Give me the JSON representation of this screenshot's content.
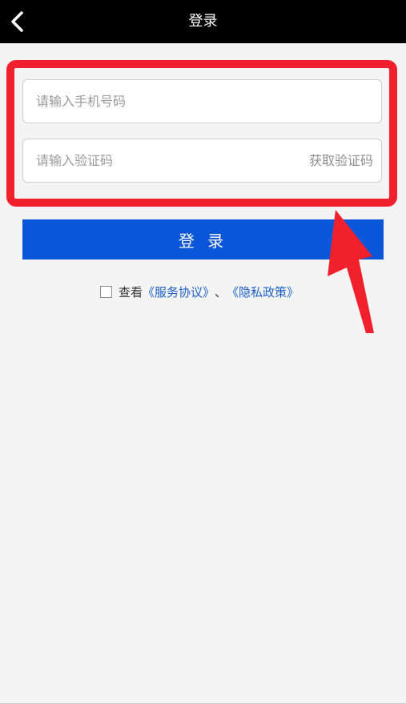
{
  "header": {
    "title": "登录",
    "back_icon": "chevron-left-icon"
  },
  "form": {
    "phone_placeholder": "请输入手机号码",
    "code_placeholder": "请输入验证码",
    "get_code_label": "获取验证码",
    "login_label": "登 录"
  },
  "agreement": {
    "prefix": "查看",
    "service_link": "《服务协议》",
    "separator": "、",
    "privacy_link": "《隐私政策》"
  },
  "colors": {
    "header_bg": "#000000",
    "primary": "#0a56d9",
    "link": "#1d5fc9",
    "highlight": "#f0212d",
    "page_bg": "#f4f4f4"
  }
}
